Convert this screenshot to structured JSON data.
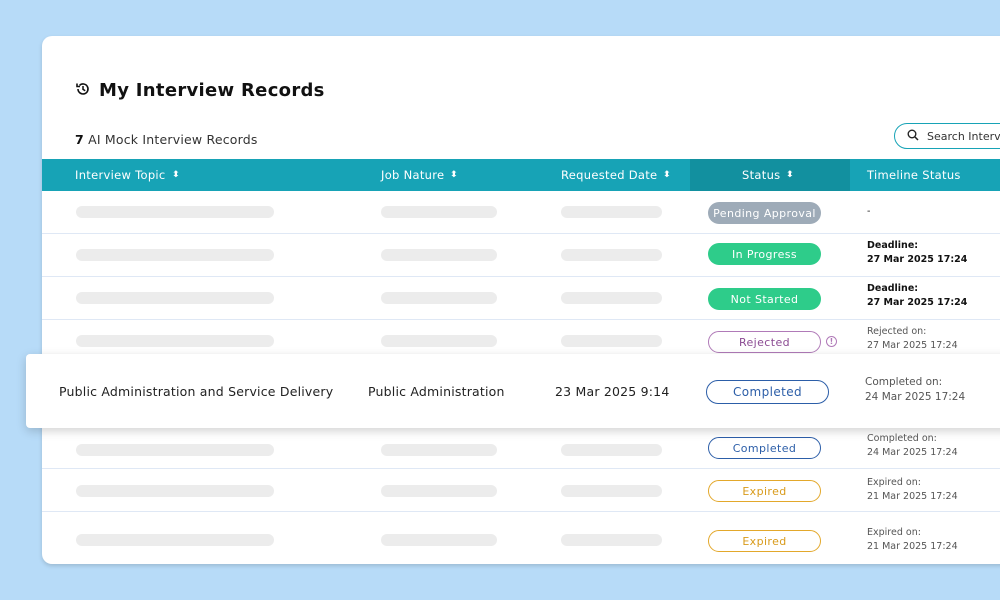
{
  "header": {
    "title": "My Interview Records",
    "count": "7",
    "count_label": "AI Mock Interview Records",
    "search_placeholder": "Search Interv"
  },
  "columns": [
    {
      "label": "Interview Topic",
      "sortable": true
    },
    {
      "label": "Job Nature",
      "sortable": true
    },
    {
      "label": "Requested Date",
      "sortable": true
    },
    {
      "label": "Status",
      "sortable": true
    },
    {
      "label": "Timeline Status",
      "sortable": false
    }
  ],
  "rows": [
    {
      "status": "Pending Approval",
      "timeline_label": "",
      "timeline_date": "-"
    },
    {
      "status": "In Progress",
      "timeline_label": "Deadline:",
      "timeline_date": "27 Mar 2025 17:24"
    },
    {
      "status": "Not Started",
      "timeline_label": "Deadline:",
      "timeline_date": "27 Mar 2025 17:24"
    },
    {
      "status": "Rejected",
      "timeline_label": "Rejected on:",
      "timeline_date": "27 Mar 2025 17:24"
    },
    {
      "status": "Completed",
      "timeline_label": "Completed on:",
      "timeline_date": "24 Mar 2025 17:24"
    },
    {
      "status": "Expired",
      "timeline_label": "Expired on:",
      "timeline_date": "21 Mar 2025 17:24"
    },
    {
      "status": "Expired",
      "timeline_label": "Expired on:",
      "timeline_date": "21 Mar 2025 17:24"
    }
  ],
  "highlighted_row": {
    "topic": "Public Administration and Service Delivery",
    "job_nature": "Public Administration",
    "requested_date": "23 Mar 2025 9:14",
    "status": "Completed",
    "timeline_label": "Completed on:",
    "timeline_date": "24 Mar 2025 17:24"
  },
  "icons": [
    "history-icon",
    "search-icon",
    "sort-icon",
    "info-icon"
  ],
  "colors": {
    "background": "#b7dbf8",
    "header_teal": "#17a3b6",
    "header_status_dark": "#12909f",
    "pending": "#9eabb8",
    "in_progress": "#2ecc8a",
    "rejected": "#b07ab8",
    "completed": "#2c5ea8",
    "expired": "#e3a82b"
  }
}
